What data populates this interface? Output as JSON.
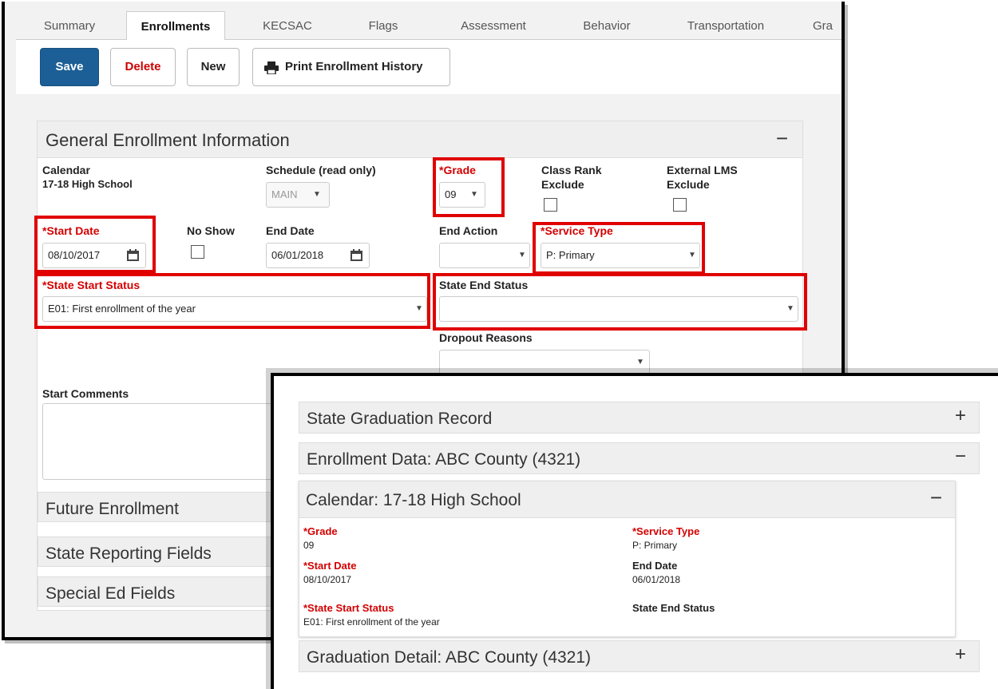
{
  "tabs": [
    "Summary",
    "Enrollments",
    "KECSAC",
    "Flags",
    "Assessment",
    "Behavior",
    "Transportation",
    "Gra"
  ],
  "toolbar": {
    "save": "Save",
    "delete": "Delete",
    "new": "New",
    "print": "Print Enrollment History"
  },
  "general": {
    "title": "General Enrollment Information",
    "toggle": "−",
    "calendar_label": "Calendar",
    "calendar_value": "17-18 High School",
    "schedule_label": "Schedule (read only)",
    "schedule_value": "MAIN",
    "grade_label": "*Grade",
    "grade_value": "09",
    "class_rank_label_1": "Class Rank",
    "class_rank_label_2": "Exclude",
    "lms_label_1": "External LMS",
    "lms_label_2": "Exclude",
    "start_date_label": "*Start Date",
    "start_date_value": "08/10/2017",
    "no_show_label": "No Show",
    "end_date_label": "End Date",
    "end_date_value": "06/01/2018",
    "end_action_label": "End Action",
    "end_action_value": "",
    "service_type_label": "*Service Type",
    "service_type_value": "P: Primary",
    "state_start_label": "*State Start Status",
    "state_start_value": "E01: First enrollment of the year",
    "state_end_label": "State End Status",
    "state_end_value": "",
    "dropout_label": "Dropout Reasons",
    "dropout_value": "",
    "start_comments_label": "Start Comments"
  },
  "sections": {
    "future": "Future Enrollment",
    "state_reporting": "State Reporting Fields",
    "special_ed": "Special Ed Fields"
  },
  "summary": {
    "state_grad": "State Graduation Record",
    "plus": "+",
    "minus": "−",
    "enrollment_data": "Enrollment Data: ABC County (4321)",
    "calendar_title": "Calendar: 17-18 High School",
    "grade_label": "*Grade",
    "grade_value": "09",
    "service_label": "*Service Type",
    "service_value": "P: Primary",
    "start_label": "*Start Date",
    "start_value": "08/10/2017",
    "end_label": "End Date",
    "end_value": "06/01/2018",
    "state_start_label": "*State Start Status",
    "state_start_value": "E01: First enrollment of the year",
    "state_end_label": "State End Status",
    "grad_detail": "Graduation Detail: ABC County (4321)"
  },
  "colors": {
    "accent": "#1c5f96",
    "required": "#d40000",
    "highlight": "#e00000"
  },
  "icons": [
    "printer-icon",
    "calendar-icon",
    "dropdown-caret-icon"
  ]
}
